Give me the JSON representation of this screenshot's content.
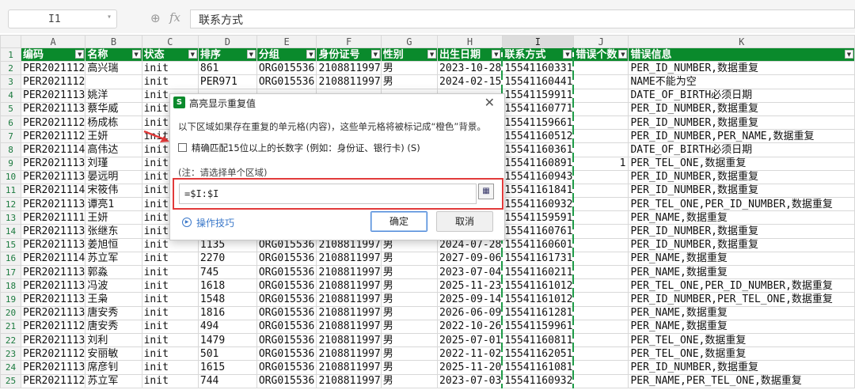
{
  "formula_bar": {
    "name_box": "I1",
    "fx_symbol": "fx",
    "zoom_icon": "magnifier-icon",
    "content": "联系方式"
  },
  "sheet": {
    "columns": [
      "A",
      "B",
      "C",
      "D",
      "E",
      "F",
      "G",
      "H",
      "I",
      "J",
      "K"
    ],
    "selected_column": "I",
    "header_color": "#0a8a2c",
    "selection_border_color": "#1e9b47",
    "headers": [
      "编码",
      "名称",
      "状态",
      "排序",
      "分组",
      "身份证号",
      "性别",
      "出生日期",
      "联系方式",
      "错误个数",
      "错误信息"
    ],
    "rows": [
      [
        "PER2021112",
        "高兴瑞",
        "init",
        "861",
        "ORG015536",
        "2108811997",
        "男",
        "2023-10-28",
        "15541160331",
        "",
        "PER_ID_NUMBER,数据重复"
      ],
      [
        "PER2021112",
        "",
        "init",
        "PER971",
        "ORG015536",
        "2108811997",
        "男",
        "2024-02-15",
        "15541160441",
        "",
        "NAME不能为空"
      ],
      [
        "PER2021113",
        "姚洋",
        "init",
        "",
        "",
        "",
        "",
        "",
        "15541159911",
        "",
        "DATE_OF_BIRTH必须日期"
      ],
      [
        "PER2021113",
        "蔡华威",
        "init",
        "",
        "",
        "",
        "",
        "",
        "15541160771",
        "",
        "PER_ID_NUMBER,数据重复"
      ],
      [
        "PER2021112",
        "杨成栋",
        "init",
        "",
        "",
        "",
        "",
        "",
        "15541159661",
        "",
        "PER_ID_NUMBER,数据重复"
      ],
      [
        "PER2021112",
        "王妍",
        "init",
        "",
        "",
        "",
        "",
        "",
        "15541160512",
        "",
        "PER_ID_NUMBER,PER_NAME,数据重复"
      ],
      [
        "PER2021114",
        "高伟达",
        "init",
        "",
        "",
        "",
        "",
        "",
        "15541160361",
        "",
        "DATE_OF_BIRTH必须日期"
      ],
      [
        "PER2021113",
        "刘瑾",
        "init",
        "",
        "",
        "",
        "",
        "",
        "15541160891",
        "1",
        "PER_TEL_ONE,数据重复"
      ],
      [
        "PER2021113",
        "晏远明",
        "init",
        "",
        "",
        "",
        "",
        "",
        "15541160943",
        "",
        "PER_ID_NUMBER,数据重复"
      ],
      [
        "PER2021114",
        "宋筱伟",
        "init",
        "",
        "",
        "",
        "",
        "",
        "15541161841",
        "",
        "PER_ID_NUMBER,数据重复"
      ],
      [
        "PER2021113",
        "谭亮1",
        "init",
        "",
        "",
        "",
        "",
        "",
        "15541160932",
        "",
        "PER_TEL_ONE,PER_ID_NUMBER,数据重复"
      ],
      [
        "PER2021111",
        "王妍",
        "init",
        "",
        "",
        "",
        "",
        "",
        "15541159591",
        "",
        "PER_NAME,数据重复"
      ],
      [
        "PER2021113",
        "张继东",
        "init",
        "",
        "",
        "",
        "",
        "",
        "15541160761",
        "",
        "PER_ID_NUMBER,数据重复"
      ],
      [
        "PER2021113",
        "姜旭恒",
        "init",
        "1135",
        "ORG015536",
        "2108811997",
        "男",
        "2024-07-28",
        "15541160601",
        "",
        "PER_ID_NUMBER,数据重复"
      ],
      [
        "PER2021114",
        "苏立军",
        "init",
        "2270",
        "ORG015536",
        "2108811997",
        "男",
        "2027-09-06",
        "15541161731",
        "",
        "PER_NAME,数据重复"
      ],
      [
        "PER2021113",
        "郭淼",
        "init",
        "745",
        "ORG015536",
        "2108811997",
        "男",
        "2023-07-04",
        "15541160211",
        "",
        "PER_NAME,数据重复"
      ],
      [
        "PER2021113",
        "冯波",
        "init",
        "1618",
        "ORG015536",
        "2108811997",
        "男",
        "2025-11-23",
        "15541161012",
        "",
        "PER_TEL_ONE,PER_ID_NUMBER,数据重复"
      ],
      [
        "PER2021113",
        "王枭",
        "init",
        "1548",
        "ORG015536",
        "2108811997",
        "男",
        "2025-09-14",
        "15541161012",
        "",
        "PER_ID_NUMBER,PER_TEL_ONE,数据重复"
      ],
      [
        "PER2021113",
        "唐安秀",
        "init",
        "1816",
        "ORG015536",
        "2108811997",
        "男",
        "2026-06-09",
        "15541161281",
        "",
        "PER_NAME,数据重复"
      ],
      [
        "PER2021112",
        "唐安秀",
        "init",
        "494",
        "ORG015536",
        "2108811997",
        "男",
        "2022-10-26",
        "15541159961",
        "",
        "PER_NAME,数据重复"
      ],
      [
        "PER2021113",
        "刘利",
        "init",
        "1479",
        "ORG015536",
        "2108811997",
        "男",
        "2025-07-01",
        "15541160811",
        "",
        "PER_TEL_ONE,数据重复"
      ],
      [
        "PER2021112",
        "安丽敏",
        "init",
        "501",
        "ORG015536",
        "2108811997",
        "男",
        "2022-11-02",
        "15541162051",
        "",
        "PER_TEL_ONE,数据重复"
      ],
      [
        "PER2021113",
        "席彦钊",
        "init",
        "1615",
        "ORG015536",
        "2108811997",
        "男",
        "2025-11-20",
        "15541161081",
        "",
        "PER_ID_NUMBER,数据重复"
      ],
      [
        "PER2021112",
        "苏立军",
        "init",
        "744",
        "ORG015536",
        "2108811997",
        "男",
        "2023-07-03",
        "15541160932",
        "",
        "PER_NAME,PER_TEL_ONE,数据重复"
      ]
    ]
  },
  "dialog": {
    "title": "高亮显示重复值",
    "logo_letter": "S",
    "close_glyph": "✕",
    "description": "以下区域如果存在重复的单元格(内容)，这些单元格将被标记成“橙色”背景。",
    "checkbox_label": "精确匹配15位以上的长数字 (例如：身份证、银行卡) (S)",
    "checkbox_checked": false,
    "note": "(注：请选择单个区域)",
    "range_value": "=$I:$I",
    "tips_label": "操作技巧",
    "ok_label": "确定",
    "cancel_label": "取消",
    "highlight_color": "#e23a3a"
  }
}
